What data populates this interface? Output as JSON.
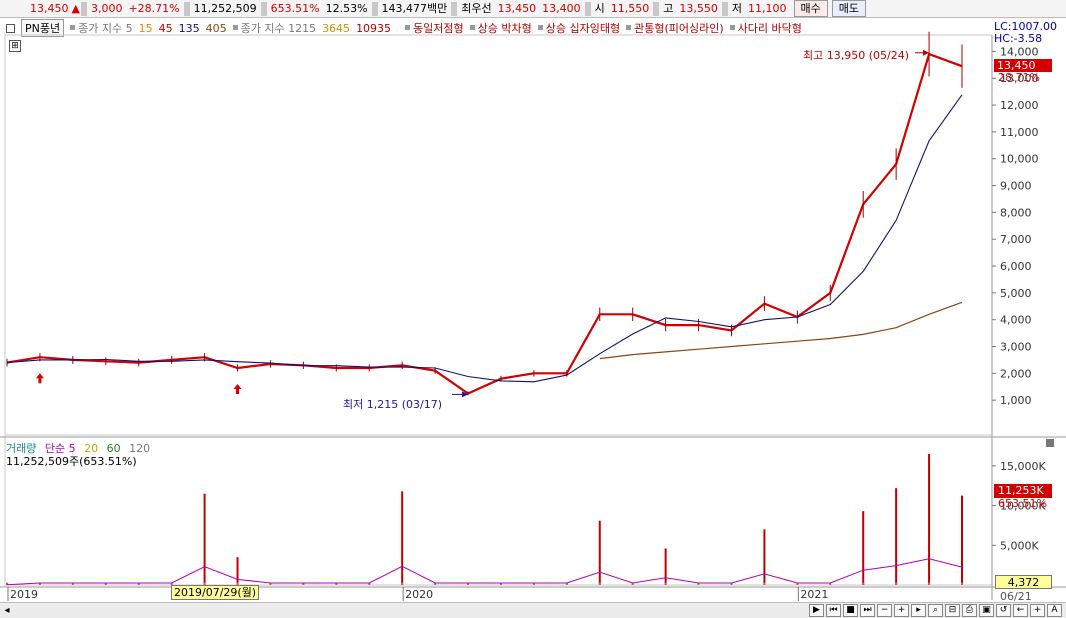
{
  "header": {
    "price": "13,450",
    "arrow": "▲",
    "change": "3,000",
    "change_pct": "+28.71%",
    "volume": "11,252,509",
    "volume_ratio": "653.51%",
    "turnover": "12.53%",
    "trade_value": "143,477백만",
    "priority_label": "최우선",
    "ask": "13,450",
    "bid": "13,400",
    "open_label": "시",
    "open": "11,550",
    "high_label": "고",
    "high": "13,550",
    "low_label": "저",
    "low": "11,100",
    "buy_label": "매수",
    "sell_label": "매도"
  },
  "legend": {
    "stock_name": "PN풍년",
    "ma_label": "종가 지수 5",
    "ma_15": "15",
    "ma_45": "45",
    "ma_135": "135",
    "ma_405": "405",
    "ma2_label": "종가 지수 1215",
    "ma2_3645": "3645",
    "ma2_10935": "10935",
    "pattern1": "동일저점형",
    "pattern2": "상승 박차형",
    "pattern3": "상승 십자잉태형",
    "pattern4": "관통형(피어싱라인)",
    "pattern5": "사다리 바닥형"
  },
  "axis_right": {
    "lc": "LC:1007.00",
    "hc": "HC:-3.58",
    "price_tag": "13,450",
    "pct_tag": "28.71%",
    "ticks": [
      "14,000",
      "13,000",
      "12,000",
      "11,000",
      "10,000",
      "9,000",
      "8,000",
      "7,000",
      "6,000",
      "5,000",
      "4,000",
      "3,000",
      "2,000",
      "1,000"
    ],
    "vol_ticks": [
      "15,000K",
      "10,000K",
      "5,000K"
    ],
    "vol_tag": "11,253K",
    "vol_pct": "653.51%",
    "bottom_box": "4,372",
    "end_date": "06/21"
  },
  "annotations": {
    "high": "최고 13,950 (05/24)",
    "low": "최저 1,215 (03/17)"
  },
  "volume_legend": {
    "label": "거래량",
    "ma_label": "단순 5",
    "ma_20": "20",
    "ma_60": "60",
    "ma_120": "120",
    "info": "11,252,509주(653.51%)"
  },
  "x_axis": {
    "labels": [
      "2019",
      "2020",
      "2021"
    ],
    "crosshair_date": "2019/07/29(월)"
  },
  "colors": {
    "candle_up": "#d20000",
    "ma_red": "#dd0000",
    "ma_orange": "#e88a00",
    "ma_navy": "#101070",
    "ma_brown": "#8b4513"
  },
  "chart_data": {
    "type": "line",
    "title": "PN풍년",
    "x": [
      "2019-01",
      "2019-02",
      "2019-03",
      "2019-04",
      "2019-05",
      "2019-06",
      "2019-07",
      "2019-08",
      "2019-09",
      "2019-10",
      "2019-11",
      "2019-12",
      "2020-01",
      "2020-02",
      "2020-03",
      "2020-04",
      "2020-05",
      "2020-06",
      "2020-07",
      "2020-08",
      "2020-09",
      "2020-10",
      "2020-11",
      "2020-12",
      "2021-01",
      "2021-02",
      "2021-03",
      "2021-04",
      "2021-05",
      "2021-06"
    ],
    "series": [
      {
        "name": "종가",
        "values": [
          2400,
          2600,
          2500,
          2450,
          2400,
          2500,
          2600,
          2200,
          2350,
          2300,
          2200,
          2200,
          2300,
          2100,
          1250,
          1800,
          2000,
          2000,
          4200,
          4200,
          3800,
          3800,
          3600,
          4600,
          4100,
          5000,
          8300,
          9800,
          13900,
          13450
        ]
      },
      {
        "name": "405",
        "values": [
          null,
          null,
          null,
          null,
          null,
          null,
          null,
          null,
          null,
          null,
          null,
          null,
          null,
          null,
          null,
          null,
          null,
          null,
          2550,
          2700,
          2800,
          2900,
          3000,
          3100,
          3200,
          3300,
          3450,
          3700,
          4200,
          4650
        ]
      }
    ],
    "ylim": [
      0,
      14500
    ],
    "annotations": [
      {
        "label": "최고 13,950 (05/24)",
        "x": "2021-05",
        "y": 13950
      },
      {
        "label": "최저 1,215 (03/17)",
        "x": "2020-03",
        "y": 1215
      }
    ],
    "volume": {
      "unit": "K",
      "x": [
        "2019-01",
        "2019-07",
        "2019-08",
        "2020-01",
        "2020-07",
        "2020-09",
        "2020-12",
        "2021-03",
        "2021-04",
        "2021-05",
        "2021-06"
      ],
      "values": [
        100,
        11500,
        3500,
        11800,
        8100,
        4600,
        7000,
        9300,
        12200,
        16500,
        11253
      ]
    },
    "grid": true,
    "legend": "top"
  }
}
